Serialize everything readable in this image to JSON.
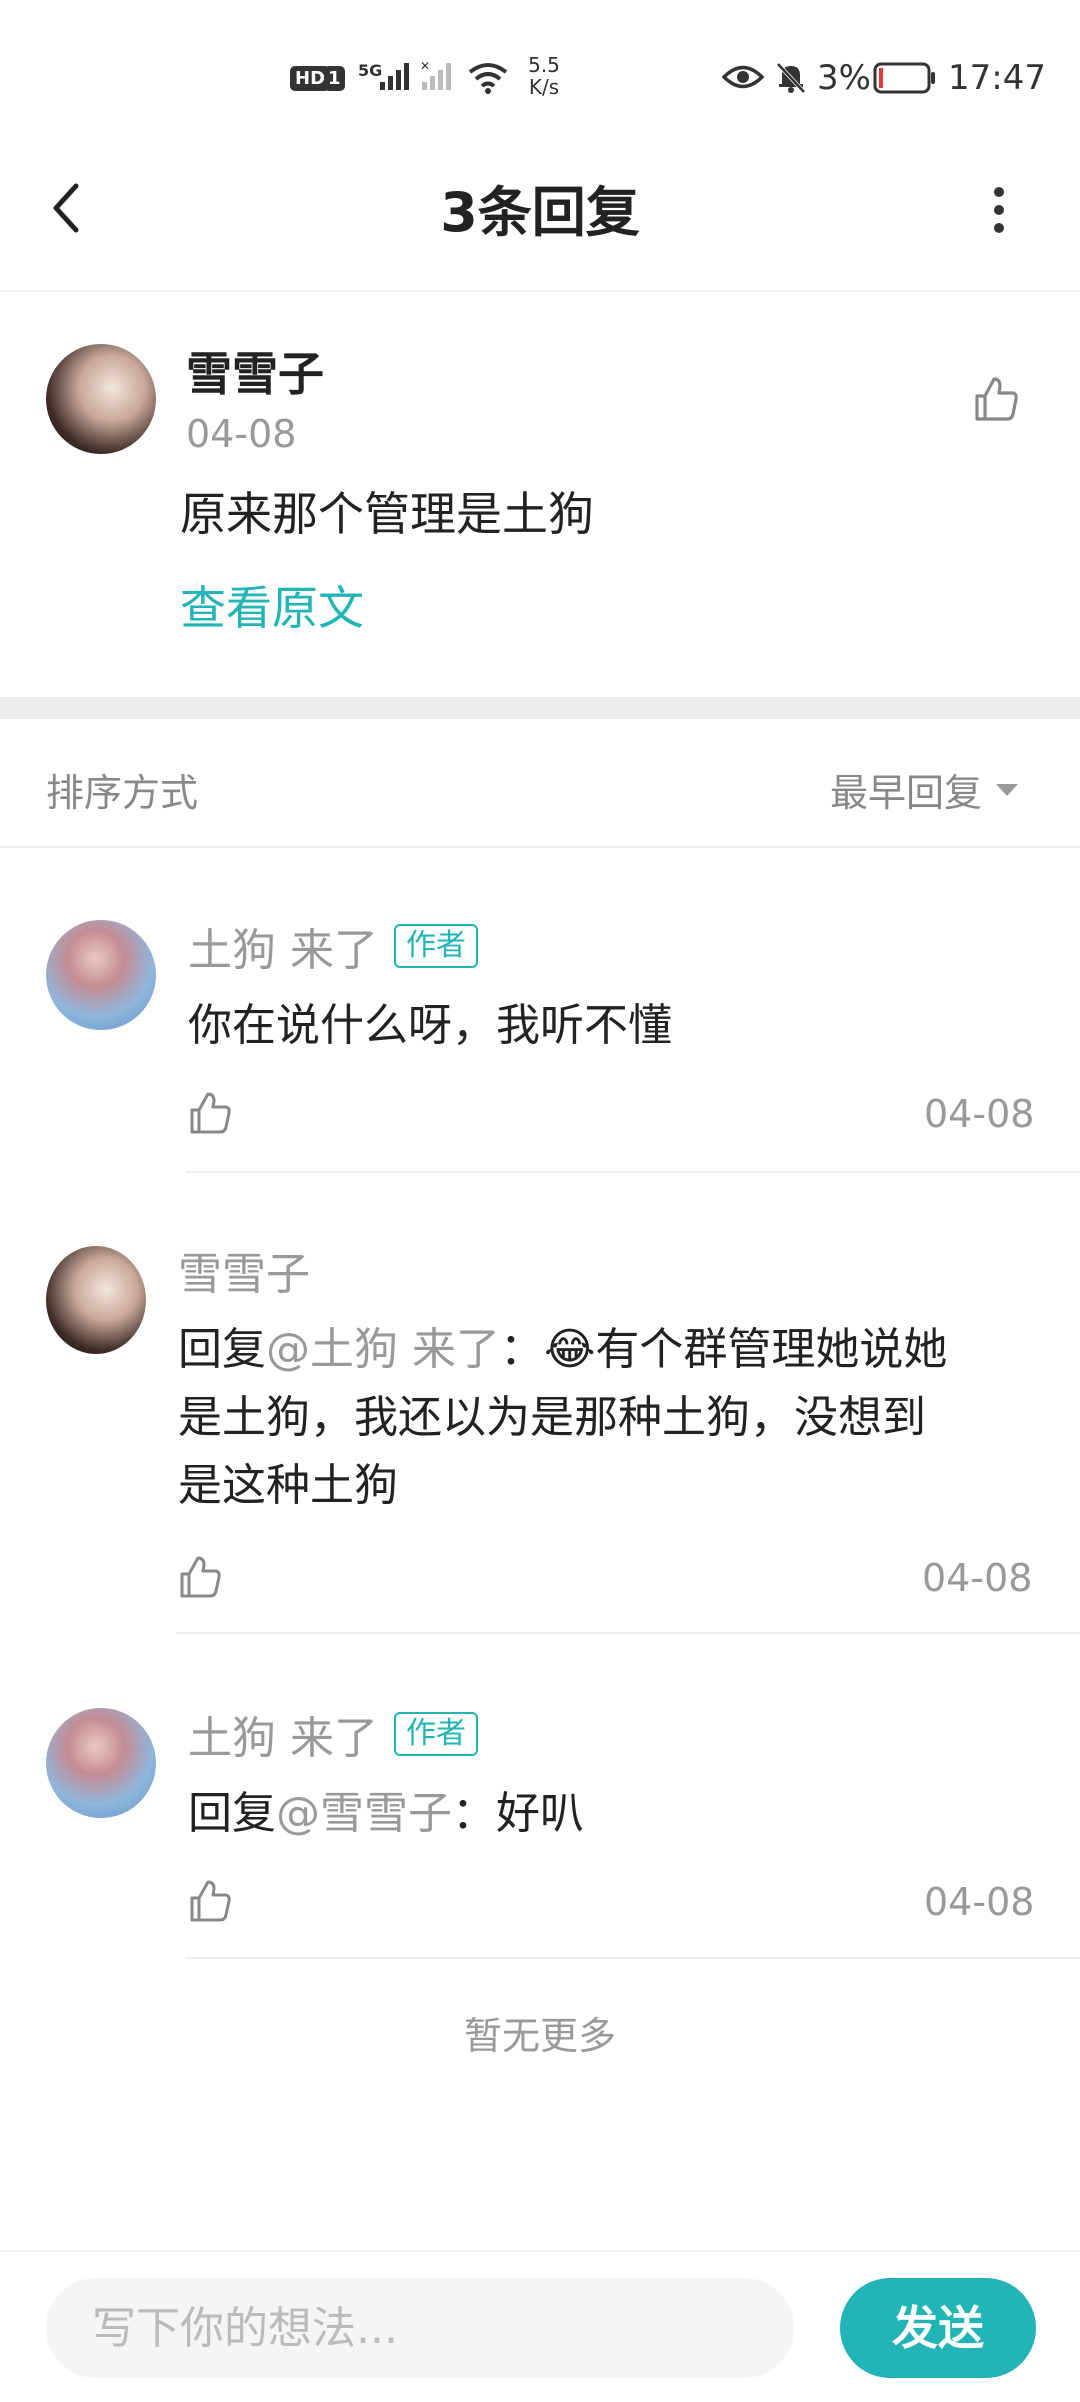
{
  "status_bar": {
    "network_badge": "HD",
    "sim": "1",
    "net_type": "5G",
    "speed": "5.5",
    "speed_unit": "K/s",
    "battery": "3%",
    "time": "17:47"
  },
  "header": {
    "title": "3条回复"
  },
  "original": {
    "author": "雪雪子",
    "date": "04-08",
    "content": "原来那个管理是土狗",
    "view_original": "查看原文"
  },
  "sort": {
    "label": "排序方式",
    "value": "最早回复"
  },
  "replies": [
    {
      "name": "土狗 来了",
      "badge": "作者",
      "text": "你在说什么呀，我听不懂",
      "date": "04-08"
    },
    {
      "name": "雪雪子",
      "prefix": "回复",
      "mention": "@土狗 来了",
      "colon": "：",
      "emoji": "😂",
      "text_line1": "有个群管理她说她",
      "text_line2": "是土狗，我还以为是那种土狗，没想到",
      "text_line3": "是这种土狗",
      "date": "04-08"
    },
    {
      "name": "土狗 来了",
      "badge": "作者",
      "prefix": "回复",
      "mention": "@雪雪子",
      "colon": "：",
      "text": "好叭",
      "date": "04-08"
    }
  ],
  "footer_note": "暂无更多",
  "composer": {
    "placeholder": "写下你的想法...",
    "send_label": "发送"
  },
  "colors": {
    "accent": "#22b4b6",
    "muted_text": "#999999",
    "divider": "#eeeeee"
  }
}
